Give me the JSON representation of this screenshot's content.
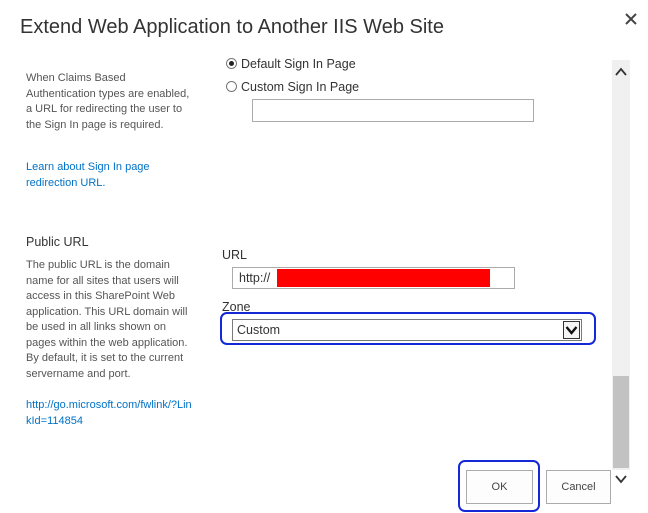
{
  "dialog": {
    "title": "Extend Web Application to Another IIS Web Site",
    "close_icon": "close-icon"
  },
  "sign_in_section": {
    "description": "When Claims Based Authentication types are enabled, a URL for redirecting the user to the Sign In page is required.",
    "link_text": "Learn about Sign In page redirection URL.",
    "options": [
      {
        "label": "Default Sign In Page",
        "checked": true
      },
      {
        "label": "Custom Sign In Page",
        "checked": false
      }
    ],
    "custom_url_value": ""
  },
  "public_url_section": {
    "heading": "Public URL",
    "description": "The public URL is the domain name for all sites that users will access in this SharePoint Web application. This URL domain will be used in all links shown on pages within the web application. By default, it is set to the current servername and port.",
    "link_text": "http://go.microsoft.com/fwlink/?LinkId=114854",
    "url_label": "URL",
    "url_value": "http://",
    "redaction_color": "#ff0000",
    "zone_label": "Zone",
    "zone_value": "Custom"
  },
  "buttons": {
    "ok": "OK",
    "cancel": "Cancel"
  },
  "colors": {
    "highlight": "#1428d6",
    "link": "#0072c6"
  }
}
